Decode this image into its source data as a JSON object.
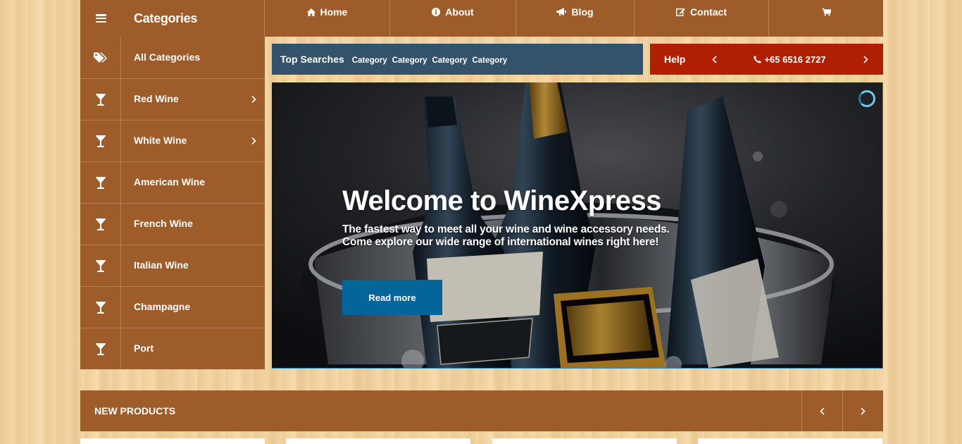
{
  "header": {
    "categories_title": "Categories",
    "nav": [
      {
        "label": "Home",
        "icon": "home-icon"
      },
      {
        "label": "About",
        "icon": "info-icon"
      },
      {
        "label": "Blog",
        "icon": "bullhorn-icon"
      },
      {
        "label": "Contact",
        "icon": "edit-icon"
      },
      {
        "label": "",
        "icon": "cart-icon"
      }
    ]
  },
  "sidebar": {
    "items": [
      {
        "label": "All Categories",
        "icon": "tags-icon",
        "has_submenu": false
      },
      {
        "label": "Red Wine",
        "icon": "wine-glass-icon",
        "has_submenu": true
      },
      {
        "label": "White Wine",
        "icon": "wine-glass-icon",
        "has_submenu": true
      },
      {
        "label": "American Wine",
        "icon": "wine-glass-icon",
        "has_submenu": false
      },
      {
        "label": "French Wine",
        "icon": "wine-glass-icon",
        "has_submenu": false
      },
      {
        "label": "Italian Wine",
        "icon": "wine-glass-icon",
        "has_submenu": false
      },
      {
        "label": "Champagne",
        "icon": "wine-glass-icon",
        "has_submenu": false
      },
      {
        "label": "Port",
        "icon": "wine-glass-icon",
        "has_submenu": false
      }
    ]
  },
  "top_searches": {
    "label": "Top Searches",
    "items": [
      "Category",
      "Category",
      "Category",
      "Category"
    ]
  },
  "help": {
    "label": "Help",
    "phone": "+65 6516 2727"
  },
  "hero": {
    "title": "Welcome to WineXpress",
    "text_line1": "The fastest way to meet all your wine and wine accessory needs.",
    "text_line2": "Come explore our wide range of international wines right here!",
    "button_label": "Read more"
  },
  "new_products": {
    "title": "NEW PRODUCTS"
  },
  "colors": {
    "brown": "#9e5c2b",
    "slate": "#34526a",
    "red": "#b11f02",
    "blue_button": "#04659a",
    "wood_background": "#f5d9a8"
  }
}
